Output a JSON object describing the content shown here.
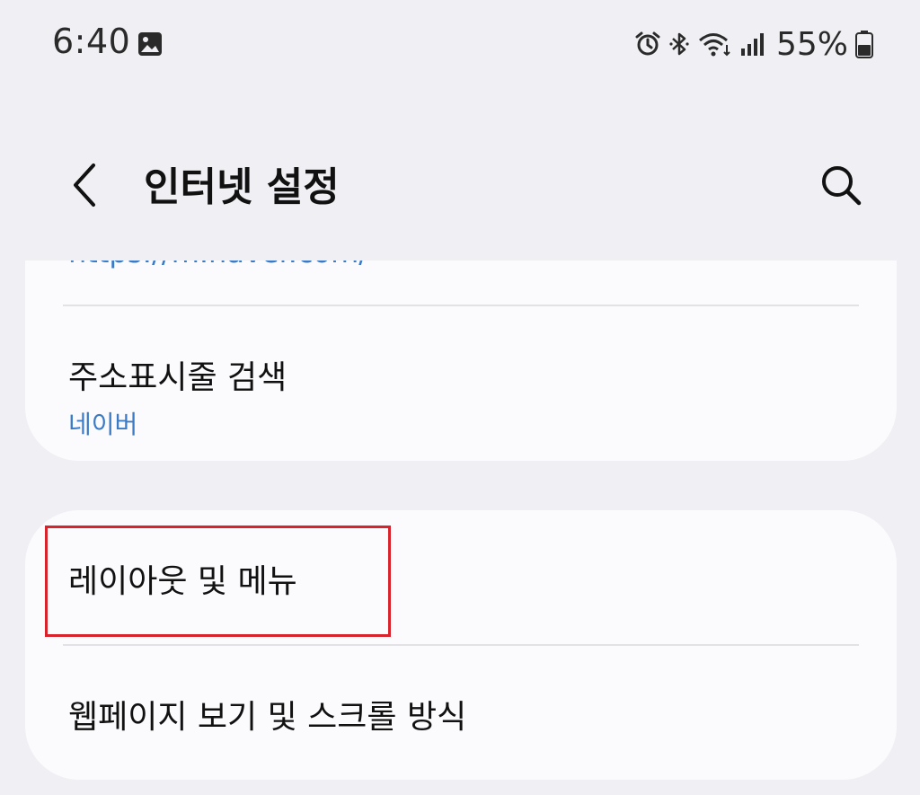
{
  "status_bar": {
    "time": "6:40",
    "battery_percent": "55%",
    "icons": [
      "gallery-icon",
      "alarm-icon",
      "bluetooth-icon",
      "wifi-icon",
      "signal-icon",
      "battery-icon"
    ]
  },
  "header": {
    "title": "인터넷 설정",
    "back_icon": "chevron-left-icon",
    "search_icon": "search-icon"
  },
  "settings": {
    "partial_url": "https://m.naver.com/",
    "address_bar_search": {
      "title": "주소표시줄 검색",
      "value": "네이버"
    },
    "layout_menu": {
      "title": "레이아웃 및 메뉴"
    },
    "webpage_view": {
      "title": "웹페이지 보기 및 스크롤 방식"
    }
  },
  "colors": {
    "background": "#f0f0f4",
    "card": "#fbfbfd",
    "accent_text": "#3b7bc6",
    "highlight": "#d9232c"
  }
}
